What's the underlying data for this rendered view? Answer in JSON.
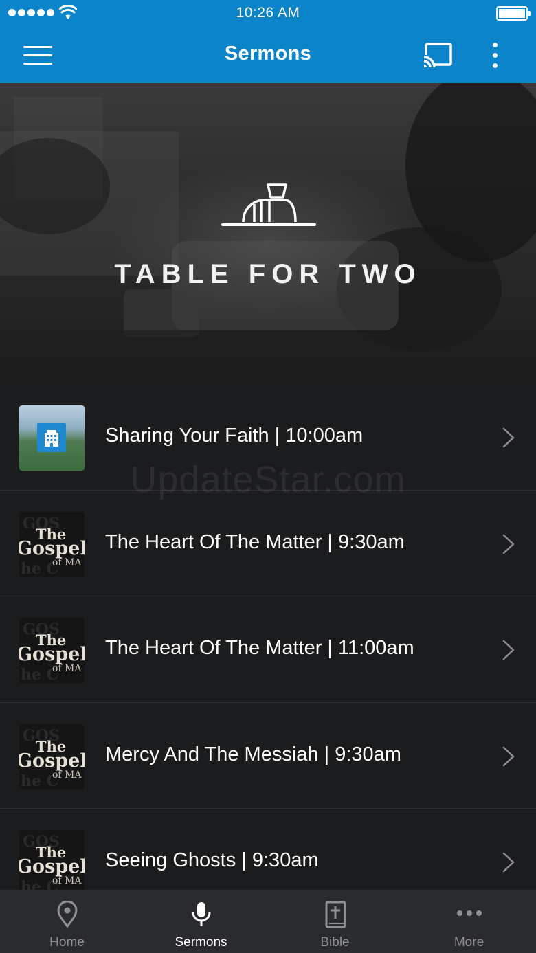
{
  "status_bar": {
    "time": "10:26 AM"
  },
  "app_bar": {
    "title": "Sermons",
    "icons": [
      "menu-icon",
      "cast-icon",
      "more-vert-icon"
    ]
  },
  "hero": {
    "title": "TABLE FOR TWO"
  },
  "watermark": "UpdateStar.com",
  "sermons": [
    {
      "title": "Sharing Your Faith | 10:00am",
      "thumb": "church-building"
    },
    {
      "title": "The Heart Of The Matter | 9:30am",
      "thumb": "gospel-series"
    },
    {
      "title": "The Heart Of The Matter | 11:00am",
      "thumb": "gospel-series"
    },
    {
      "title": "Mercy And The Messiah | 9:30am",
      "thumb": "gospel-series"
    },
    {
      "title": "Seeing Ghosts | 9:30am",
      "thumb": "gospel-series"
    }
  ],
  "gospel_thumb": {
    "line1": "The",
    "line2": "Gospel",
    "line3": "of MA"
  },
  "tabs": [
    {
      "label": "Home",
      "icon": "location-pin-icon"
    },
    {
      "label": "Sermons",
      "icon": "microphone-icon",
      "active": true
    },
    {
      "label": "Bible",
      "icon": "bible-icon"
    },
    {
      "label": "More",
      "icon": "more-horiz-icon"
    }
  ],
  "colors": {
    "app_bar": "#0b84c9",
    "background": "#1b1c1e",
    "tab_bar": "#2a2b2e"
  }
}
